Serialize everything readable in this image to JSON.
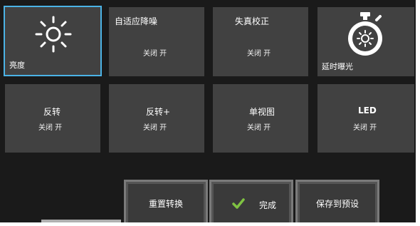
{
  "tiles": [
    {
      "title": "亮度",
      "icon": "sun-icon"
    },
    {
      "title": "自适应降噪",
      "status": "关闭 开"
    },
    {
      "title": "失真校正",
      "status": "关闭 开"
    },
    {
      "title": "延时曝光",
      "icon": "timer-icon"
    },
    {
      "title": "反转",
      "status": "关闭 开"
    },
    {
      "title": "反转+",
      "status": "关闭 开"
    },
    {
      "title": "单视图",
      "status": "关闭 开"
    },
    {
      "title": "LED",
      "status": "关闭 开"
    }
  ],
  "buttons": {
    "reset": "重置转换",
    "done": "完成",
    "save": "保存到预设"
  },
  "colors": {
    "tile": "#414141",
    "selection": "#4bb3e6",
    "check": "#7fc242",
    "background": "#1a1a1a"
  }
}
